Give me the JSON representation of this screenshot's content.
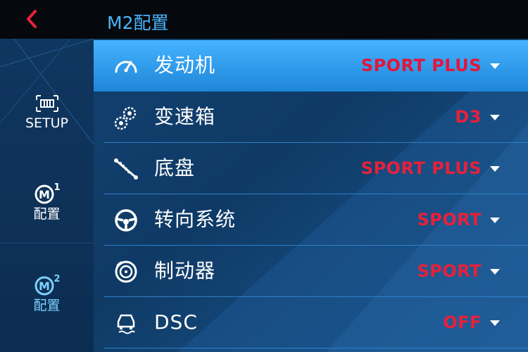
{
  "header": {
    "title": "M2配置",
    "back_icon": "chevron-left-icon",
    "accent": "#e8203a"
  },
  "sidebar": {
    "items": [
      {
        "label": "SETUP",
        "icon": "setup-grid-icon"
      },
      {
        "label": "配置",
        "icon": "m1-badge-icon",
        "badge": "1"
      },
      {
        "label": "配置",
        "icon": "m2-badge-icon",
        "badge": "2",
        "active": true
      }
    ]
  },
  "settings": [
    {
      "label": "发动机",
      "value": "SPORT PLUS",
      "icon": "speedometer-icon",
      "selected": true
    },
    {
      "label": "变速箱",
      "value": "D3",
      "icon": "gears-icon"
    },
    {
      "label": "底盘",
      "value": "SPORT PLUS",
      "icon": "shock-absorber-icon"
    },
    {
      "label": "转向系统",
      "value": "SPORT",
      "icon": "steering-wheel-icon"
    },
    {
      "label": "制动器",
      "value": "SPORT",
      "icon": "brake-disc-icon"
    },
    {
      "label": "DSC",
      "value": "OFF",
      "icon": "dsc-car-icon"
    }
  ],
  "colors": {
    "value_red": "#e8203a",
    "selected_blue": "#45b3ff",
    "title_blue": "#49b6ff"
  }
}
